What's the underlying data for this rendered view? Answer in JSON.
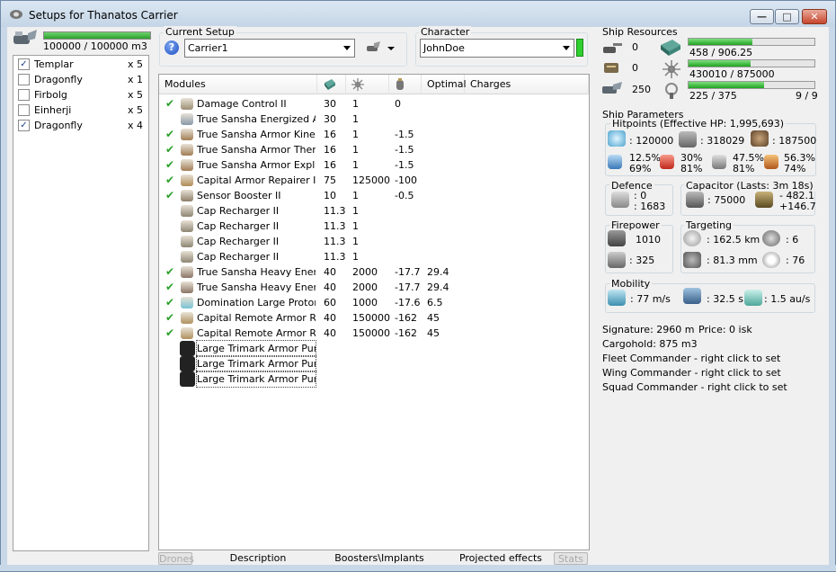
{
  "window": {
    "title": "Setups for Thanatos Carrier",
    "minimize_glyph": "—",
    "maximize_glyph": "□",
    "close_glyph": "✕"
  },
  "fleet": {
    "capacity_text": "100000 / 100000 m3",
    "capacity_fraction": 1.0,
    "items": [
      {
        "name": "Templar",
        "count": "x 5",
        "checked": true
      },
      {
        "name": "Dragonfly",
        "count": "x 1",
        "checked": false
      },
      {
        "name": "Firbolg",
        "count": "x 5",
        "checked": false
      },
      {
        "name": "Einherji",
        "count": "x 5",
        "checked": false
      },
      {
        "name": "Dragonfly",
        "count": "x 4",
        "checked": true
      }
    ]
  },
  "setup": {
    "label": "Current Setup",
    "value": "Carrier1",
    "help_glyph": "?"
  },
  "character": {
    "label": "Character",
    "value": "JohnDoe"
  },
  "modules": {
    "headers": {
      "modules": "Modules",
      "optimal": "Optimal",
      "charges": "Charges"
    },
    "rows": [
      {
        "check": "✔",
        "name": "Damage Control II",
        "c1": "30",
        "c2": "1",
        "c3": "0",
        "c4": "",
        "icon": "damage-control-icon"
      },
      {
        "check": "",
        "name": "True Sansha Energized A...",
        "c1": "30",
        "c2": "1",
        "c3": "",
        "c4": "",
        "icon": "armor-membrane-icon"
      },
      {
        "check": "✔",
        "name": "True Sansha Armor Kineti...",
        "c1": "16",
        "c2": "1",
        "c3": "-1.5",
        "c4": "",
        "icon": "armor-hardener-icon"
      },
      {
        "check": "✔",
        "name": "True Sansha Armor Ther...",
        "c1": "16",
        "c2": "1",
        "c3": "-1.5",
        "c4": "",
        "icon": "armor-hardener-icon"
      },
      {
        "check": "✔",
        "name": "True Sansha Armor Explo...",
        "c1": "16",
        "c2": "1",
        "c3": "-1.5",
        "c4": "",
        "icon": "armor-hardener-icon"
      },
      {
        "check": "✔",
        "name": "Capital Armor Repairer I",
        "c1": "75",
        "c2": "125000",
        "c3": "-100",
        "c4": "",
        "icon": "armor-repairer-icon"
      },
      {
        "check": "✔",
        "name": "Sensor Booster II",
        "c1": "10",
        "c2": "1",
        "c3": "-0.5",
        "c4": "",
        "icon": "sensor-booster-icon"
      },
      {
        "check": "",
        "name": "Cap Recharger II",
        "c1": "11.3",
        "c2": "1",
        "c3": "",
        "c4": "",
        "icon": "cap-recharger-icon"
      },
      {
        "check": "",
        "name": "Cap Recharger II",
        "c1": "11.3",
        "c2": "1",
        "c3": "",
        "c4": "",
        "icon": "cap-recharger-icon"
      },
      {
        "check": "",
        "name": "Cap Recharger II",
        "c1": "11.3",
        "c2": "1",
        "c3": "",
        "c4": "",
        "icon": "cap-recharger-icon"
      },
      {
        "check": "",
        "name": "Cap Recharger II",
        "c1": "11.3",
        "c2": "1",
        "c3": "",
        "c4": "",
        "icon": "cap-recharger-icon"
      },
      {
        "check": "✔",
        "name": "True Sansha Heavy Ener...",
        "c1": "40",
        "c2": "2000",
        "c3": "-17.7",
        "c4": "29.4",
        "icon": "energy-neutralizer-icon"
      },
      {
        "check": "✔",
        "name": "True Sansha Heavy Ener...",
        "c1": "40",
        "c2": "2000",
        "c3": "-17.7",
        "c4": "29.4",
        "icon": "energy-neutralizer-icon"
      },
      {
        "check": "✔",
        "name": "Domination Large Proton ...",
        "c1": "60",
        "c2": "1000",
        "c3": "-17.6",
        "c4": "6.5",
        "icon": "smartbomb-icon"
      },
      {
        "check": "✔",
        "name": "Capital Remote Armor Re...",
        "c1": "40",
        "c2": "150000",
        "c3": "-162",
        "c4": "45",
        "icon": "remote-armor-repairer-icon"
      },
      {
        "check": "✔",
        "name": "Capital Remote Armor Re...",
        "c1": "40",
        "c2": "150000",
        "c3": "-162",
        "c4": "45",
        "icon": "remote-armor-repairer-icon"
      },
      {
        "check": "",
        "name": "Large Trimark Armor Pump I",
        "c1": "",
        "c2": "",
        "c3": "",
        "c4": "",
        "icon": "rig-icon"
      },
      {
        "check": "",
        "name": "Large Trimark Armor Pump I",
        "c1": "",
        "c2": "",
        "c3": "",
        "c4": "",
        "icon": "rig-icon"
      },
      {
        "check": "",
        "name": "Large Trimark Armor Pump I",
        "c1": "",
        "c2": "",
        "c3": "",
        "c4": "",
        "icon": "rig-icon"
      }
    ]
  },
  "tabs": [
    "Drones",
    "Description",
    "Boosters\\Implants",
    "Projected effects",
    "Stats"
  ],
  "resources": {
    "label": "Ship Resources",
    "turret_slots": "0",
    "launcher_slots": "0",
    "drone_bay": "250",
    "cpu": {
      "text": "458 / 906.25",
      "fraction": 0.505
    },
    "powergrid": {
      "text": "430010 / 875000",
      "fraction": 0.491
    },
    "calibration": {
      "text": "225 / 375",
      "fraction": 0.6
    },
    "slots_text": "9 / 9"
  },
  "params": {
    "label": "Ship Parameters",
    "hitpoints_label": "Hitpoints (Effective HP: 1,995,693)",
    "hp_shield": ": 120000",
    "hp_armor": ": 318029",
    "hp_structure": ": 187500",
    "resist_em_top": "12.5%",
    "resist_em_bottom": "69%",
    "resist_th_top": "30%",
    "resist_th_bottom": "81%",
    "resist_ki_top": "47.5%",
    "resist_ki_bottom": "81%",
    "resist_ex_top": "56.3%",
    "resist_ex_bottom": "74%",
    "defence_label": "Defence",
    "defence_top": ": 0",
    "defence_bottom": ": 1683",
    "capacitor_label": "Capacitor (Lasts: 3m 18s)",
    "capacitor_value": ": 75000",
    "capacitor_delta_top": "- 482.1",
    "capacitor_delta_bottom": "+146.7",
    "firepower_label": "Firepower",
    "firepower_top": "1010",
    "firepower_bottom": ": 325",
    "targeting_label": "Targeting",
    "targeting_range": ": 162.5 km",
    "targeting_max": ": 6",
    "targeting_scan": ": 81.3 mm",
    "targeting_sig": ": 76",
    "mobility_label": "Mobility",
    "mobility_speed": ": 77 m/s",
    "mobility_align": ": 32.5 s",
    "mobility_warp": ": 1.5 au/s",
    "signature": "Signature: 2960 m",
    "price": "Price: 0 isk",
    "cargohold": "Cargohold: 875 m3",
    "fleet_commander": "Fleet Commander - right click to set",
    "wing_commander": "Wing Commander - right click to set",
    "squad_commander": "Squad Commander - right click to set"
  },
  "colors": {
    "accent_green": "#2ca02c",
    "check_green": "#2b9f2b",
    "titlebar": "#c5d5e6"
  }
}
